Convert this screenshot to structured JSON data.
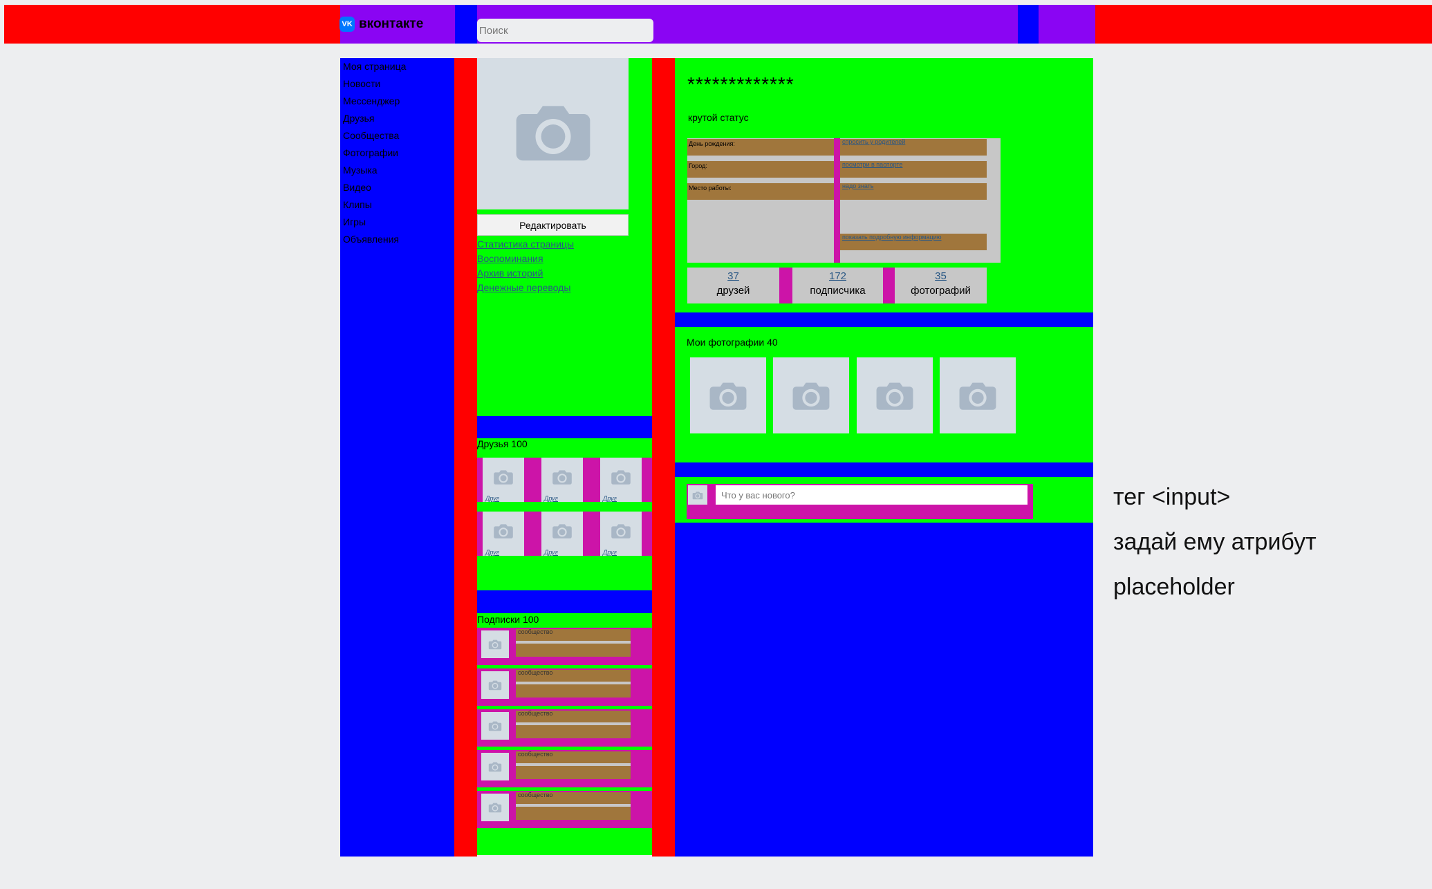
{
  "header": {
    "logo_text": "вконтакте",
    "logo_icon": "vk-logo-icon",
    "search_placeholder": "Поиск"
  },
  "sidebar": {
    "items": [
      {
        "label": "Моя страница"
      },
      {
        "label": "Новости"
      },
      {
        "label": "Мессенджер"
      },
      {
        "label": "Друзья"
      },
      {
        "label": "Сообщества"
      },
      {
        "label": "Фотографии"
      },
      {
        "label": "Музыка"
      },
      {
        "label": "Видео"
      },
      {
        "label": "Клипы"
      },
      {
        "label": "Игры"
      },
      {
        "label": "Объявления"
      }
    ]
  },
  "profile_column": {
    "edit_button": "Редактировать",
    "links": [
      "Статистика страницы",
      "Воспоминания",
      "Архив историй",
      "Денежные переводы"
    ],
    "friends_title": "Друзья 100",
    "friend_label": "Друг",
    "subscriptions_title": "Подписки 100",
    "community_label": "сообщество"
  },
  "profile": {
    "name": "*************",
    "status": "крутой статус",
    "info": {
      "birthday_label": "День рождения:",
      "city_label": "Город:",
      "work_label": "Место работы:",
      "birthday_value": "спросить у родителей",
      "city_value": "посмотри в паспорте",
      "work_value": "надо знать",
      "more_link": "показать подробную информацию"
    },
    "counters": [
      {
        "value": "37",
        "label": "друзей"
      },
      {
        "value": "172",
        "label": "подписчика"
      },
      {
        "value": "35",
        "label": "фотографий"
      }
    ]
  },
  "photos": {
    "title": "Мои фотографии 40"
  },
  "post": {
    "placeholder": "Что у вас нового?"
  },
  "annotation": {
    "line1": "тег <input>",
    "line2": "задай ему атрибут",
    "line3": "placeholder"
  },
  "colors": {
    "red": "#ff0000",
    "blue": "#0000ff",
    "green": "#00ff00",
    "purple": "#8a05f3",
    "magenta": "#cc14a8",
    "brown": "#a0763c",
    "link": "#2a5885",
    "page_bg": "#edeef0"
  }
}
